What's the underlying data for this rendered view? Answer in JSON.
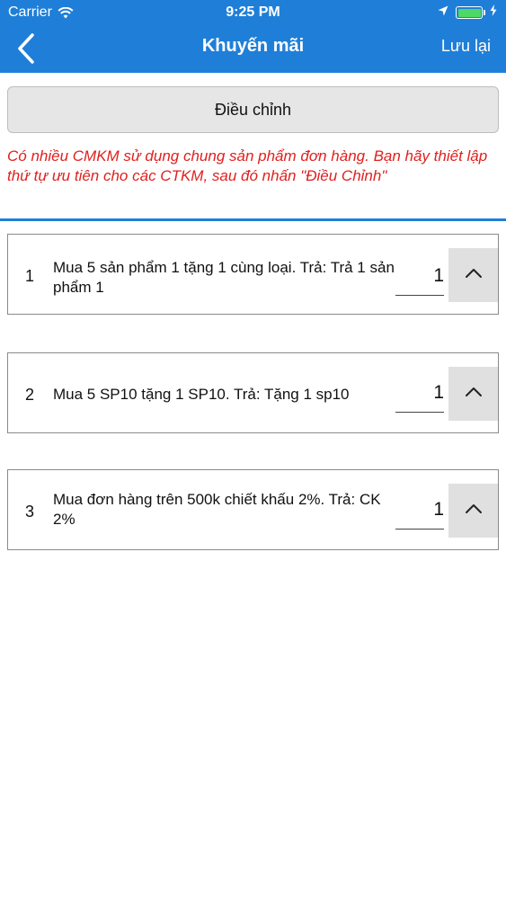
{
  "status_bar": {
    "carrier": "Carrier",
    "time": "9:25 PM"
  },
  "header": {
    "title": "Khuyến mãi",
    "save_label": "Lưu lại",
    "background": "#1f7fd8"
  },
  "adjust_button": {
    "label": "Điều chỉnh"
  },
  "notice": {
    "text": "Có nhiều CMKM sử dụng chung sản phẩm đơn hàng. Bạn hãy thiết lập thứ tự ưu tiên cho các CTKM, sau đó nhấn \"Điều Chỉnh\"",
    "color": "#e0201e"
  },
  "promotions": [
    {
      "index": "1",
      "description": "Mua 5 sản phẩm 1 tặng 1 cùng loại. Trả: Trả 1 sản phẩm 1",
      "priority": "1"
    },
    {
      "index": "2",
      "description": "Mua 5 SP10 tặng 1 SP10. Trả: Tặng 1 sp10",
      "priority": "1"
    },
    {
      "index": "3",
      "description": "Mua đơn hàng trên 500k chiết khấu 2%. Trả: CK 2%",
      "priority": "1"
    }
  ]
}
